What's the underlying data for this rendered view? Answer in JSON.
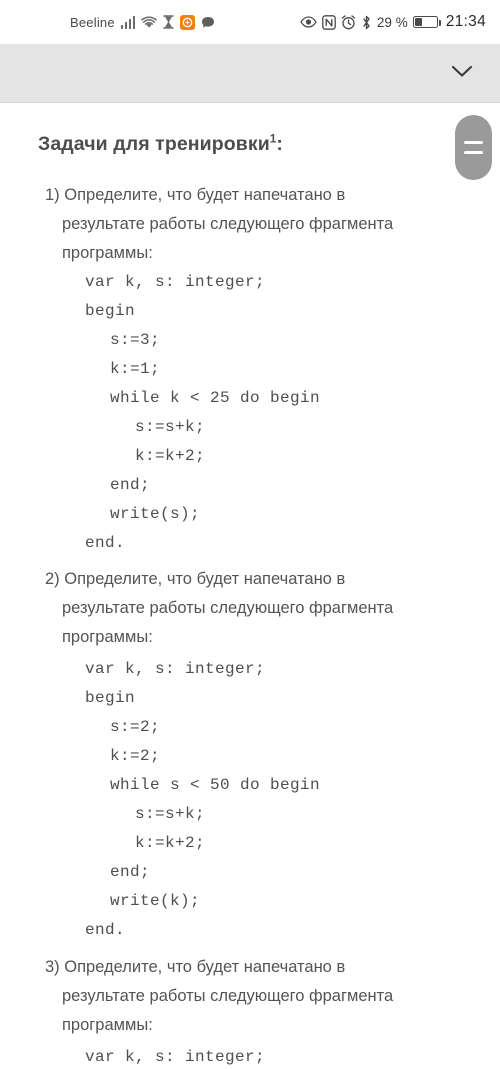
{
  "status_bar": {
    "carrier": "Beeline",
    "battery_percent": "29 %",
    "clock": "21:34",
    "left_icons": [
      "signal-bars-icon",
      "wifi-icon",
      "hourglass-icon",
      "app-orange-icon",
      "message-bubble-icon"
    ],
    "right_icons": [
      "eye-icon",
      "nfc-icon",
      "alarm-clock-icon",
      "bluetooth-icon",
      "battery-icon"
    ]
  },
  "toolbar": {
    "collapse_icon": "chevron-down-icon"
  },
  "document": {
    "title": "Задачи для тренировки",
    "title_superscript": "1",
    "title_suffix": ":",
    "tasks": [
      {
        "number": "1)",
        "prompt_lines": [
          "Определите, что будет напечатано в",
          "результате работы следующего фрагмента",
          "программы:"
        ],
        "code": [
          {
            "indent": 0,
            "text": "var k, s: integer;"
          },
          {
            "indent": 0,
            "text": "begin"
          },
          {
            "indent": 1,
            "text": "s:=3;"
          },
          {
            "indent": 1,
            "text": "k:=1;"
          },
          {
            "indent": 1,
            "text": "while k < 25 do begin"
          },
          {
            "indent": 2,
            "text": "s:=s+k;"
          },
          {
            "indent": 2,
            "text": "k:=k+2;"
          },
          {
            "indent": 1,
            "text": "end;"
          },
          {
            "indent": 1,
            "text": "write(s);"
          },
          {
            "indent": 0,
            "text": "end."
          }
        ]
      },
      {
        "number": "2)",
        "prompt_lines": [
          "Определите, что будет напечатано в",
          "результате работы следующего фрагмента",
          "программы:"
        ],
        "code": [
          {
            "indent": 0,
            "text": "var k, s: integer;"
          },
          {
            "indent": 0,
            "text": "begin"
          },
          {
            "indent": 1,
            "text": "s:=2;"
          },
          {
            "indent": 1,
            "text": "k:=2;"
          },
          {
            "indent": 1,
            "text": "while s < 50 do begin"
          },
          {
            "indent": 2,
            "text": "s:=s+k;"
          },
          {
            "indent": 2,
            "text": "k:=k+2;"
          },
          {
            "indent": 1,
            "text": "end;"
          },
          {
            "indent": 1,
            "text": "write(k);"
          },
          {
            "indent": 0,
            "text": "end."
          }
        ]
      },
      {
        "number": "3)",
        "prompt_lines": [
          "Определите, что будет напечатано в",
          "результате работы следующего фрагмента",
          "программы:"
        ],
        "code": [
          {
            "indent": 0,
            "text": "var k, s: integer;"
          }
        ]
      }
    ]
  },
  "scrollbar": {
    "handle_icon": "drag-handle-icon"
  },
  "colors": {
    "toolbar_bg": "#e4e4e4",
    "text": "#545454",
    "title": "#4d4d4d",
    "accent_orange": "#f2820c",
    "scroll_handle": "#9a9a9a"
  }
}
